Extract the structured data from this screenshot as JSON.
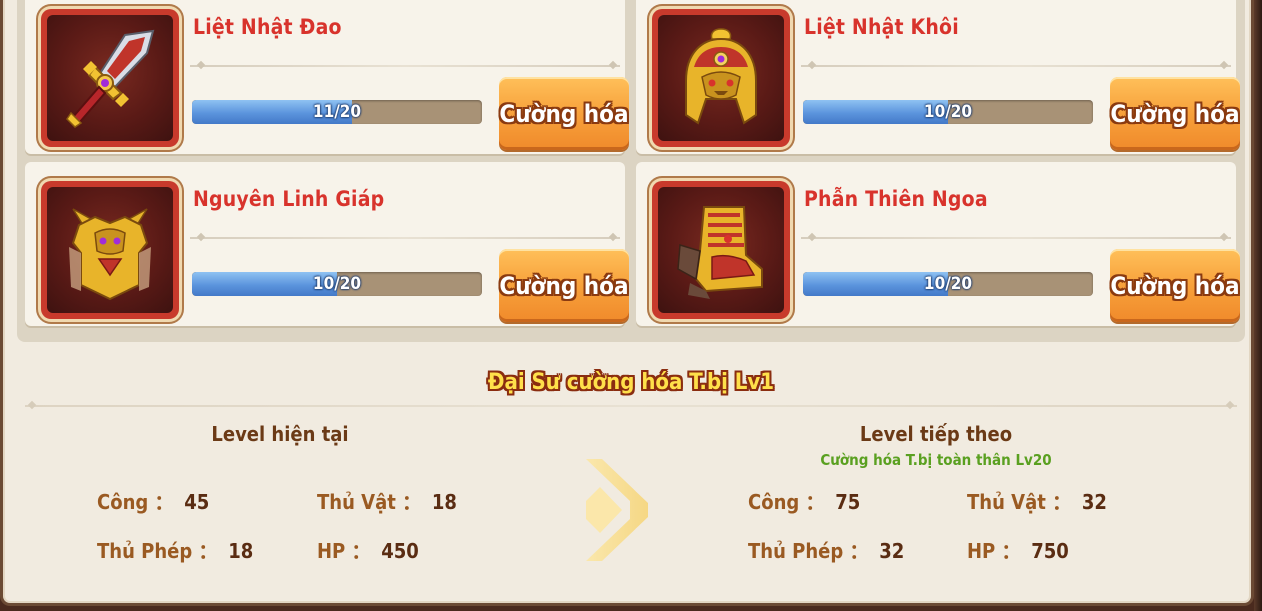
{
  "equipment": [
    {
      "name": "Liệt Nhật Đao",
      "progress_text": "11/20",
      "progress": 0.55,
      "button_label": "Cường hóa",
      "icon": "sword-icon"
    },
    {
      "name": "Liệt Nhật Khôi",
      "progress_text": "10/20",
      "progress": 0.5,
      "button_label": "Cường hóa",
      "icon": "helmet-icon"
    },
    {
      "name": "Nguyên Linh Giáp",
      "progress_text": "10/20",
      "progress": 0.5,
      "button_label": "Cường hóa",
      "icon": "armor-icon"
    },
    {
      "name": "Phẫn Thiên Ngoa",
      "progress_text": "10/20",
      "progress": 0.5,
      "button_label": "Cường hóa",
      "icon": "boots-icon"
    }
  ],
  "master": {
    "title": "Đại Sư cường hóa T.bị Lv1",
    "current": {
      "heading": "Level hiện tại",
      "stats": [
        {
          "label": "Công",
          "value": "45"
        },
        {
          "label": "Thủ Vật",
          "value": "18"
        },
        {
          "label": "Thủ Phép",
          "value": "18"
        },
        {
          "label": "HP",
          "value": "450"
        }
      ]
    },
    "next": {
      "heading": "Level tiếp theo",
      "requirement": "Cường hóa T.bị toàn thân Lv20",
      "stats": [
        {
          "label": "Công",
          "value": "75"
        },
        {
          "label": "Thủ Vật",
          "value": "32"
        },
        {
          "label": "Thủ Phép",
          "value": "32"
        },
        {
          "label": "HP",
          "value": "750"
        }
      ]
    },
    "separator": "：",
    "arrow_icon": "double-chevron-right-icon"
  },
  "colors": {
    "name_red": "#d8332c",
    "button_orange": "#f7a13b",
    "bar_blue": "#5b94dd",
    "title_yellow": "#ffe04a",
    "requirement_green": "#5aa020"
  }
}
